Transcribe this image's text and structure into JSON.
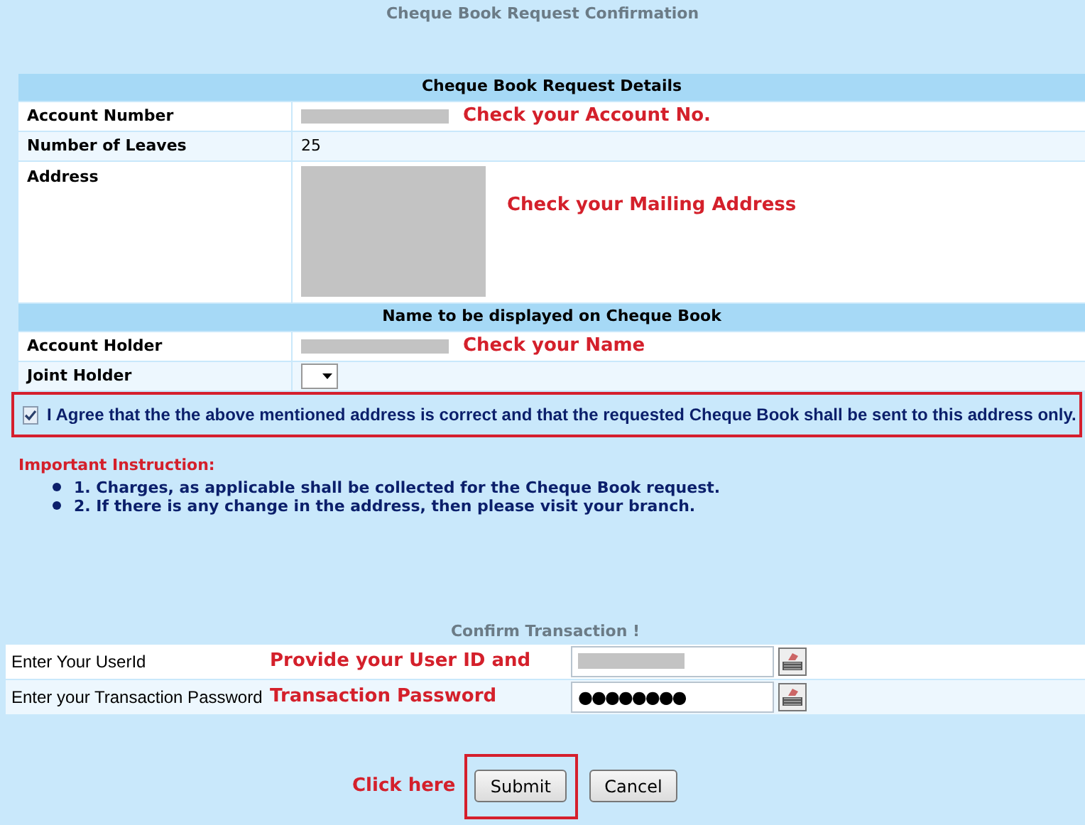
{
  "title": "Cheque Book Request Confirmation",
  "details": {
    "header": "Cheque Book Request Details",
    "rows": [
      {
        "label": "Account Number",
        "kind": "redacted",
        "note": "Check your Account No."
      },
      {
        "label": "Number of Leaves",
        "kind": "text",
        "value": "25"
      },
      {
        "label": "Address",
        "kind": "redacted-block",
        "note": "Check your Mailing Address"
      }
    ]
  },
  "name_section": {
    "header": "Name to be displayed on Cheque Book",
    "rows": [
      {
        "label": "Account Holder",
        "kind": "redacted",
        "note": "Check your Name"
      },
      {
        "label": "Joint Holder",
        "kind": "select"
      }
    ]
  },
  "agreement": {
    "checked": true,
    "text": "I Agree that the the above mentioned address is correct and that the requested Cheque Book shall be sent to this address only."
  },
  "instructions": {
    "heading": "Important Instruction:",
    "items": [
      "1. Charges, as applicable shall be collected for the Cheque Book request.",
      "2. If there is any change in the address, then please visit your branch."
    ]
  },
  "confirm": {
    "heading": "Confirm Transaction !",
    "note_lines": [
      "Provide your User ID and",
      "Transaction Password"
    ],
    "rows": [
      {
        "label": "Enter Your UserId",
        "kind": "redacted"
      },
      {
        "label": "Enter your Transaction Password",
        "kind": "password",
        "value": "●●●●●●●●"
      }
    ]
  },
  "click_note": "Click here",
  "buttons": [
    {
      "label": "Submit",
      "highlighted": true
    },
    {
      "label": "Cancel",
      "highlighted": false
    }
  ]
}
